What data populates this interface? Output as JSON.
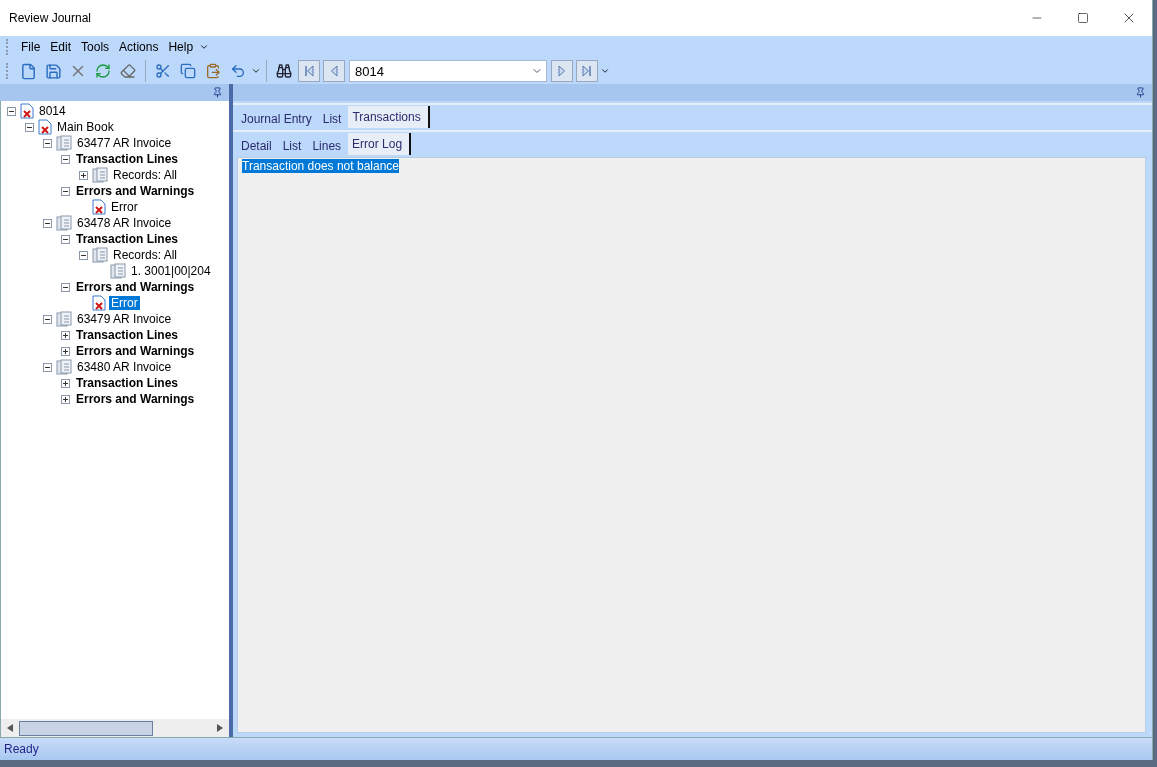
{
  "window": {
    "title": "Review Journal"
  },
  "menu": [
    "File",
    "Edit",
    "Tools",
    "Actions",
    "Help"
  ],
  "navigator": {
    "value": "8014"
  },
  "tree": [
    {
      "label": "8014",
      "kind": "error",
      "expanded": true,
      "selected": false,
      "children": [
        {
          "label": "Main Book",
          "kind": "error",
          "expanded": true,
          "selected": false,
          "children": [
            {
              "label": "63477 AR Invoice",
              "kind": "book",
              "expanded": true,
              "selected": false,
              "children": [
                {
                  "label": "Transaction Lines",
                  "kind": "group",
                  "expanded": true,
                  "selected": false,
                  "children": [
                    {
                      "label": "Records: All",
                      "kind": "book",
                      "expanded": false,
                      "selected": false
                    }
                  ]
                },
                {
                  "label": "Errors and Warnings",
                  "kind": "group",
                  "expanded": true,
                  "selected": false,
                  "children": [
                    {
                      "label": "Error",
                      "kind": "error",
                      "selected": false
                    }
                  ]
                }
              ]
            },
            {
              "label": "63478 AR Invoice",
              "kind": "book",
              "expanded": true,
              "selected": false,
              "children": [
                {
                  "label": "Transaction Lines",
                  "kind": "group",
                  "expanded": true,
                  "selected": false,
                  "children": [
                    {
                      "label": "Records: All",
                      "kind": "book",
                      "expanded": true,
                      "selected": false,
                      "children": [
                        {
                          "label": "1. 3001|00|204",
                          "kind": "book",
                          "selected": false
                        }
                      ]
                    }
                  ]
                },
                {
                  "label": "Errors and Warnings",
                  "kind": "group",
                  "expanded": true,
                  "selected": false,
                  "children": [
                    {
                      "label": "Error",
                      "kind": "error",
                      "selected": true
                    }
                  ]
                }
              ]
            },
            {
              "label": "63479 AR Invoice",
              "kind": "book",
              "expanded": true,
              "selected": false,
              "children": [
                {
                  "label": "Transaction Lines",
                  "kind": "group",
                  "expanded": false,
                  "selected": false
                },
                {
                  "label": "Errors and Warnings",
                  "kind": "group",
                  "expanded": false,
                  "selected": false
                }
              ]
            },
            {
              "label": "63480 AR Invoice",
              "kind": "book",
              "expanded": true,
              "selected": false,
              "children": [
                {
                  "label": "Transaction Lines",
                  "kind": "group",
                  "expanded": false,
                  "selected": false
                },
                {
                  "label": "Errors and Warnings",
                  "kind": "group",
                  "expanded": false,
                  "selected": false
                }
              ]
            }
          ]
        }
      ]
    }
  ],
  "tabs": [
    {
      "label": "Journal Entry",
      "selected": false
    },
    {
      "label": "List",
      "selected": false
    },
    {
      "label": "Transactions",
      "selected": true
    }
  ],
  "subtabs": [
    {
      "label": "Detail",
      "selected": false
    },
    {
      "label": "List",
      "selected": false
    },
    {
      "label": "Lines",
      "selected": false
    },
    {
      "label": "Error Log",
      "selected": true
    }
  ],
  "error_log": [
    {
      "text": "Transaction does not balance",
      "selected": true
    }
  ],
  "status_bar": "Ready"
}
